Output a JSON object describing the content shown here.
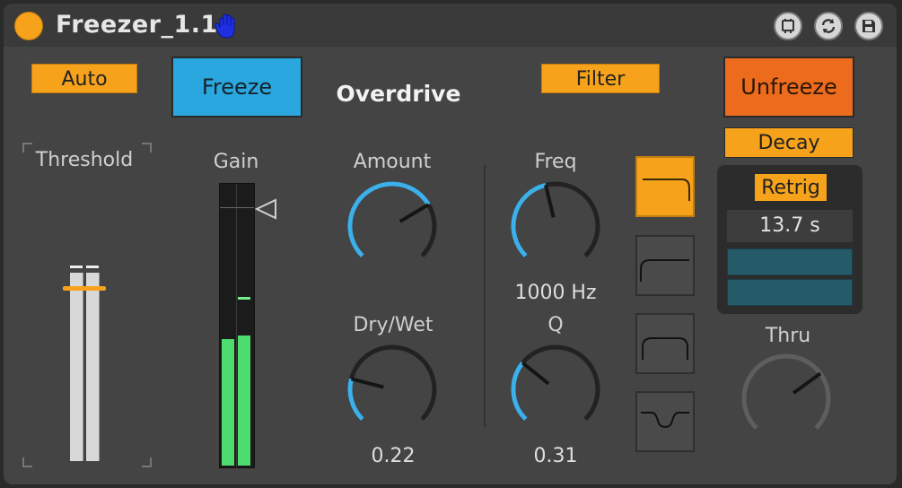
{
  "titlebar": {
    "title": "Freezer_1.1",
    "icons": [
      "power-icon",
      "hand-icon",
      "fold-icon",
      "hot-swap-icon",
      "save-icon"
    ]
  },
  "controls": {
    "auto": "Auto",
    "freeze": "Freeze",
    "overdrive": "Overdrive",
    "filter": "Filter",
    "unfreeze": "Unfreeze",
    "decay": "Decay",
    "retrig": "Retrig",
    "retrig_time": "13.7 s"
  },
  "labels": {
    "threshold": "Threshold",
    "gain": "Gain",
    "amount": "Amount",
    "drywet": "Dry/Wet",
    "freq": "Freq",
    "q": "Q",
    "thru": "Thru"
  },
  "values": {
    "freq": "1000 Hz",
    "drywet": "0.22",
    "q": "0.31"
  },
  "knobs": {
    "amount": 0.72,
    "drywet": 0.22,
    "freq": 0.45,
    "q": 0.31,
    "thru": 0.7
  },
  "meters": {
    "gain_level": 0.46,
    "gain_peak": 0.6,
    "threshold_level": 0.66
  },
  "colors": {
    "accent_orange": "#f7a21b",
    "freeze_blue": "#2aa7de",
    "unfreeze_orange": "#ec6b1c",
    "meter_green": "#4fdc6e",
    "knob_arc": "#3cb0ea",
    "panel": "#444444"
  }
}
